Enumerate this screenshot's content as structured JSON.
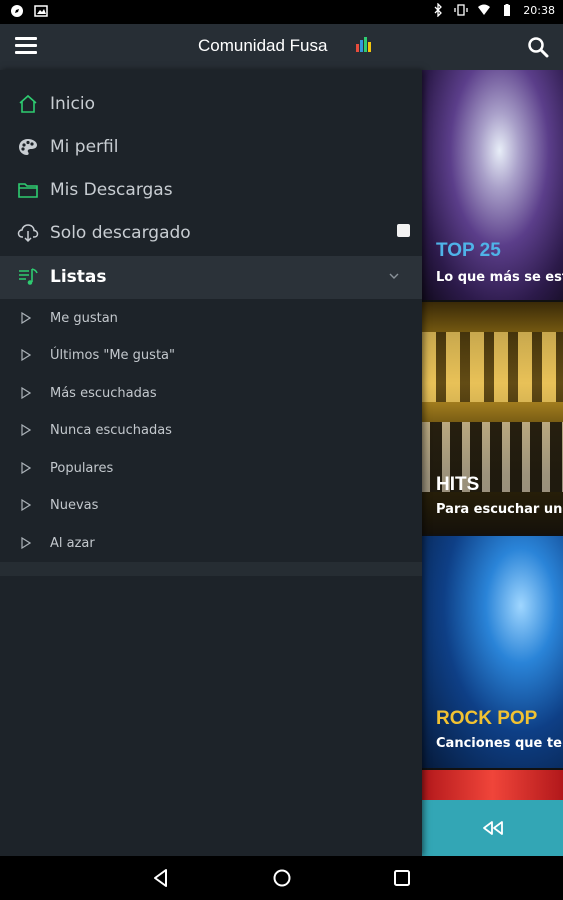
{
  "status_bar": {
    "time": "20:38"
  },
  "app_bar": {
    "title": "Comunidad Fusa"
  },
  "drawer": {
    "main_items": [
      {
        "label": "Inicio"
      },
      {
        "label": "Mi perfil"
      },
      {
        "label": "Mis Descargas"
      },
      {
        "label": "Solo descargado"
      },
      {
        "label": "Listas"
      }
    ],
    "sub_items": [
      {
        "label": "Me gustan"
      },
      {
        "label": "Últimos \"Me gusta\""
      },
      {
        "label": "Más escuchadas"
      },
      {
        "label": "Nunca escuchadas"
      },
      {
        "label": "Populares"
      },
      {
        "label": "Nuevas"
      },
      {
        "label": "Al azar"
      }
    ],
    "solo_descargado_checked": false
  },
  "cards": [
    {
      "title": "TOP 25",
      "subtitle": "Lo que más se esta",
      "title_color": "#4fb3e8"
    },
    {
      "title": "HITS",
      "subtitle": "Para escuchar una",
      "title_color": "#ffffff"
    },
    {
      "title": "ROCK POP",
      "subtitle": "Canciones que te v",
      "title_color": "#f1c232"
    }
  ],
  "colors": {
    "accent_green": "#2ecc71",
    "teal_bar": "#33a6b5",
    "drawer_bg": "#1d2329",
    "appbar_bg": "#272e35"
  }
}
